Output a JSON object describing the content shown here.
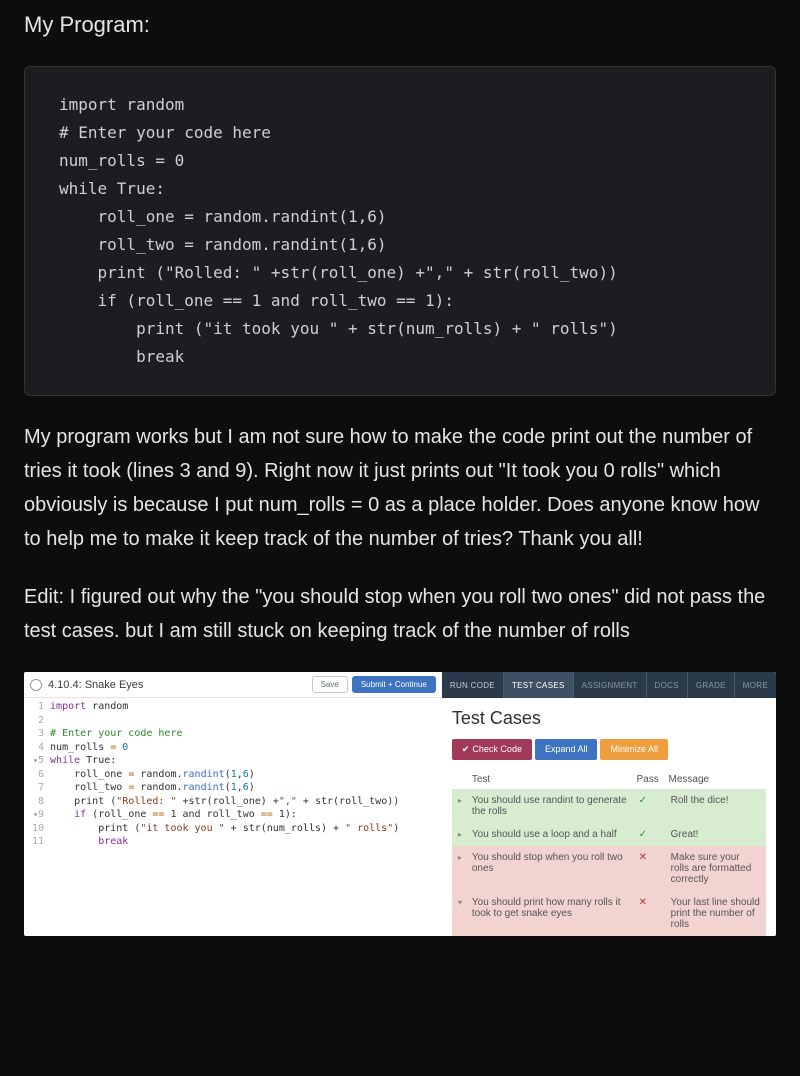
{
  "heading": "My Program:",
  "code_block": "import random\n# Enter your code here\nnum_rolls = 0\nwhile True:\n    roll_one = random.randint(1,6)\n    roll_two = random.randint(1,6)\n    print (\"Rolled: \" +str(roll_one) +\",\" + str(roll_two))\n    if (roll_one == 1 and roll_two == 1):\n        print (\"it took you \" + str(num_rolls) + \" rolls\")\n        break",
  "paragraph1": "My program works but I am not sure how to make the code print out the number of tries it took (lines 3 and 9). Right now it just prints out \"It took you 0 rolls\" which obviously is because I put num_rolls = 0 as a place holder. Does anyone know how to help me to make it keep track of the number of tries? Thank you all!",
  "paragraph2": "Edit: I figured out why the \"you should stop when you roll two ones\" did not pass the test cases. but I am still stuck on keeping track of the number of rolls",
  "ide": {
    "title": "4.10.4: Snake Eyes",
    "save": "Save",
    "submit": "Submit + Continue",
    "tabs": {
      "run": "RUN CODE",
      "tests": "TEST CASES",
      "assignment": "ASSIGNMENT",
      "docs": "DOCS",
      "grade": "GRADE",
      "more": "MORE"
    },
    "tests_title": "Test Cases",
    "pills": {
      "check": "Check Code",
      "expand": "Expand All",
      "minimize": "Minimize All"
    },
    "columns": {
      "test": "Test",
      "pass": "Pass",
      "message": "Message"
    },
    "rows": [
      {
        "test": "You should use randint to generate the rolls",
        "pass": true,
        "message": "Roll the dice!"
      },
      {
        "test": "You should use a loop and a half",
        "pass": true,
        "message": "Great!"
      },
      {
        "test": "You should stop when you roll two ones",
        "pass": false,
        "message": "Make sure your rolls are formatted correctly"
      },
      {
        "test": "You should print how many rolls it took to get snake eyes",
        "pass": false,
        "message": "Your last line should print the number of rolls"
      }
    ],
    "lines": {
      "l1a": "import",
      "l1b": " random",
      "l3": "# Enter your code here",
      "l4a": "num_rolls ",
      "l4b": "=",
      "l4c": " 0",
      "l5a": "while",
      "l5b": " True:",
      "l6a": "    roll_one ",
      "l6b": "=",
      "l6c": " random.",
      "l6d": "randint",
      "l6e": "(",
      "l6f": "1",
      "l6g": ",",
      "l6h": "6",
      "l6i": ")",
      "l7a": "    roll_two ",
      "l7b": "=",
      "l7c": " random.",
      "l7d": "randint",
      "l7e": "(",
      "l7f": "1",
      "l7g": ",",
      "l7h": "6",
      "l7i": ")",
      "l8a": "    print (",
      "l8b": "\"Rolled: \"",
      "l8c": " +str(roll_one) +",
      "l8d": "\",\"",
      "l8e": " + str(roll_two))",
      "l9a": "    if",
      "l9b": " (roll_one ",
      "l9c": "==",
      "l9d": " 1 and roll_two ",
      "l9e": "==",
      "l9f": " 1):",
      "l10a": "        print (",
      "l10b": "\"it took you \"",
      "l10c": " + str(num_rolls) + ",
      "l10d": "\" rolls\"",
      "l10e": ")",
      "l11": "        break"
    },
    "gutter": [
      "1",
      "2",
      "3",
      "4",
      "5",
      "6",
      "7",
      "8",
      "9",
      "10",
      "11"
    ]
  }
}
